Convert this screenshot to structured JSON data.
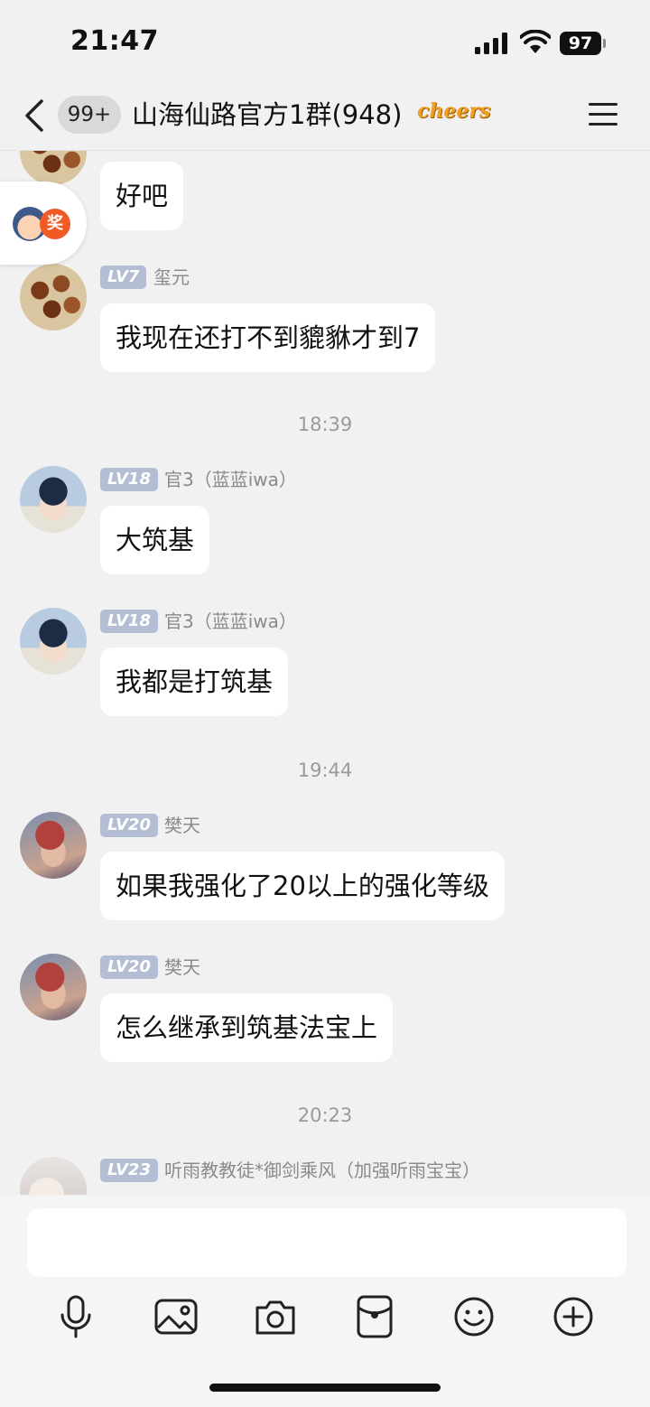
{
  "status_bar": {
    "time": "21:47",
    "battery": "97",
    "icons": [
      "signal-icon",
      "wifi-icon",
      "battery-icon"
    ]
  },
  "nav": {
    "back_icon": "chevron-left-icon",
    "unread_count": "99+",
    "title": "山海仙路官方1群(948)",
    "badge_text": "cheers",
    "menu_icon": "hamburger-menu-icon"
  },
  "messages": [
    {
      "avatar": "skewer",
      "text": "好吧"
    },
    {
      "avatar": "skewer",
      "level": "LV7",
      "sender": "玺元",
      "text": "我现在还打不到貔貅才到7"
    },
    {
      "time": "18:39"
    },
    {
      "avatar": "boy",
      "level": "LV18",
      "sender": "官3（蓝蓝iwa）",
      "text": "大筑基"
    },
    {
      "avatar": "boy",
      "level": "LV18",
      "sender": "官3（蓝蓝iwa）",
      "text": "我都是打筑基"
    },
    {
      "time": "19:44"
    },
    {
      "avatar": "red",
      "level": "LV20",
      "sender": "樊天",
      "text": "如果我强化了20以上的强化等级"
    },
    {
      "avatar": "red",
      "level": "LV20",
      "sender": "樊天",
      "text": "怎么继承到筑基法宝上"
    },
    {
      "time": "20:23"
    },
    {
      "avatar": "girl",
      "level": "LV23",
      "sender": "听雨教教徒*御剑乘风（加强听雨宝宝）"
    }
  ],
  "floating_widget": {
    "badge": "奖"
  },
  "input": {
    "value": "",
    "placeholder": ""
  },
  "toolbar": [
    "microphone-icon",
    "image-icon",
    "camera-icon",
    "red-packet-icon",
    "emoji-icon",
    "plus-icon"
  ],
  "colors": {
    "background": "#f1f1f1",
    "bubble": "#ffffff",
    "level_badge": "#b3bdd3",
    "timestamp": "#9a9a9a"
  }
}
